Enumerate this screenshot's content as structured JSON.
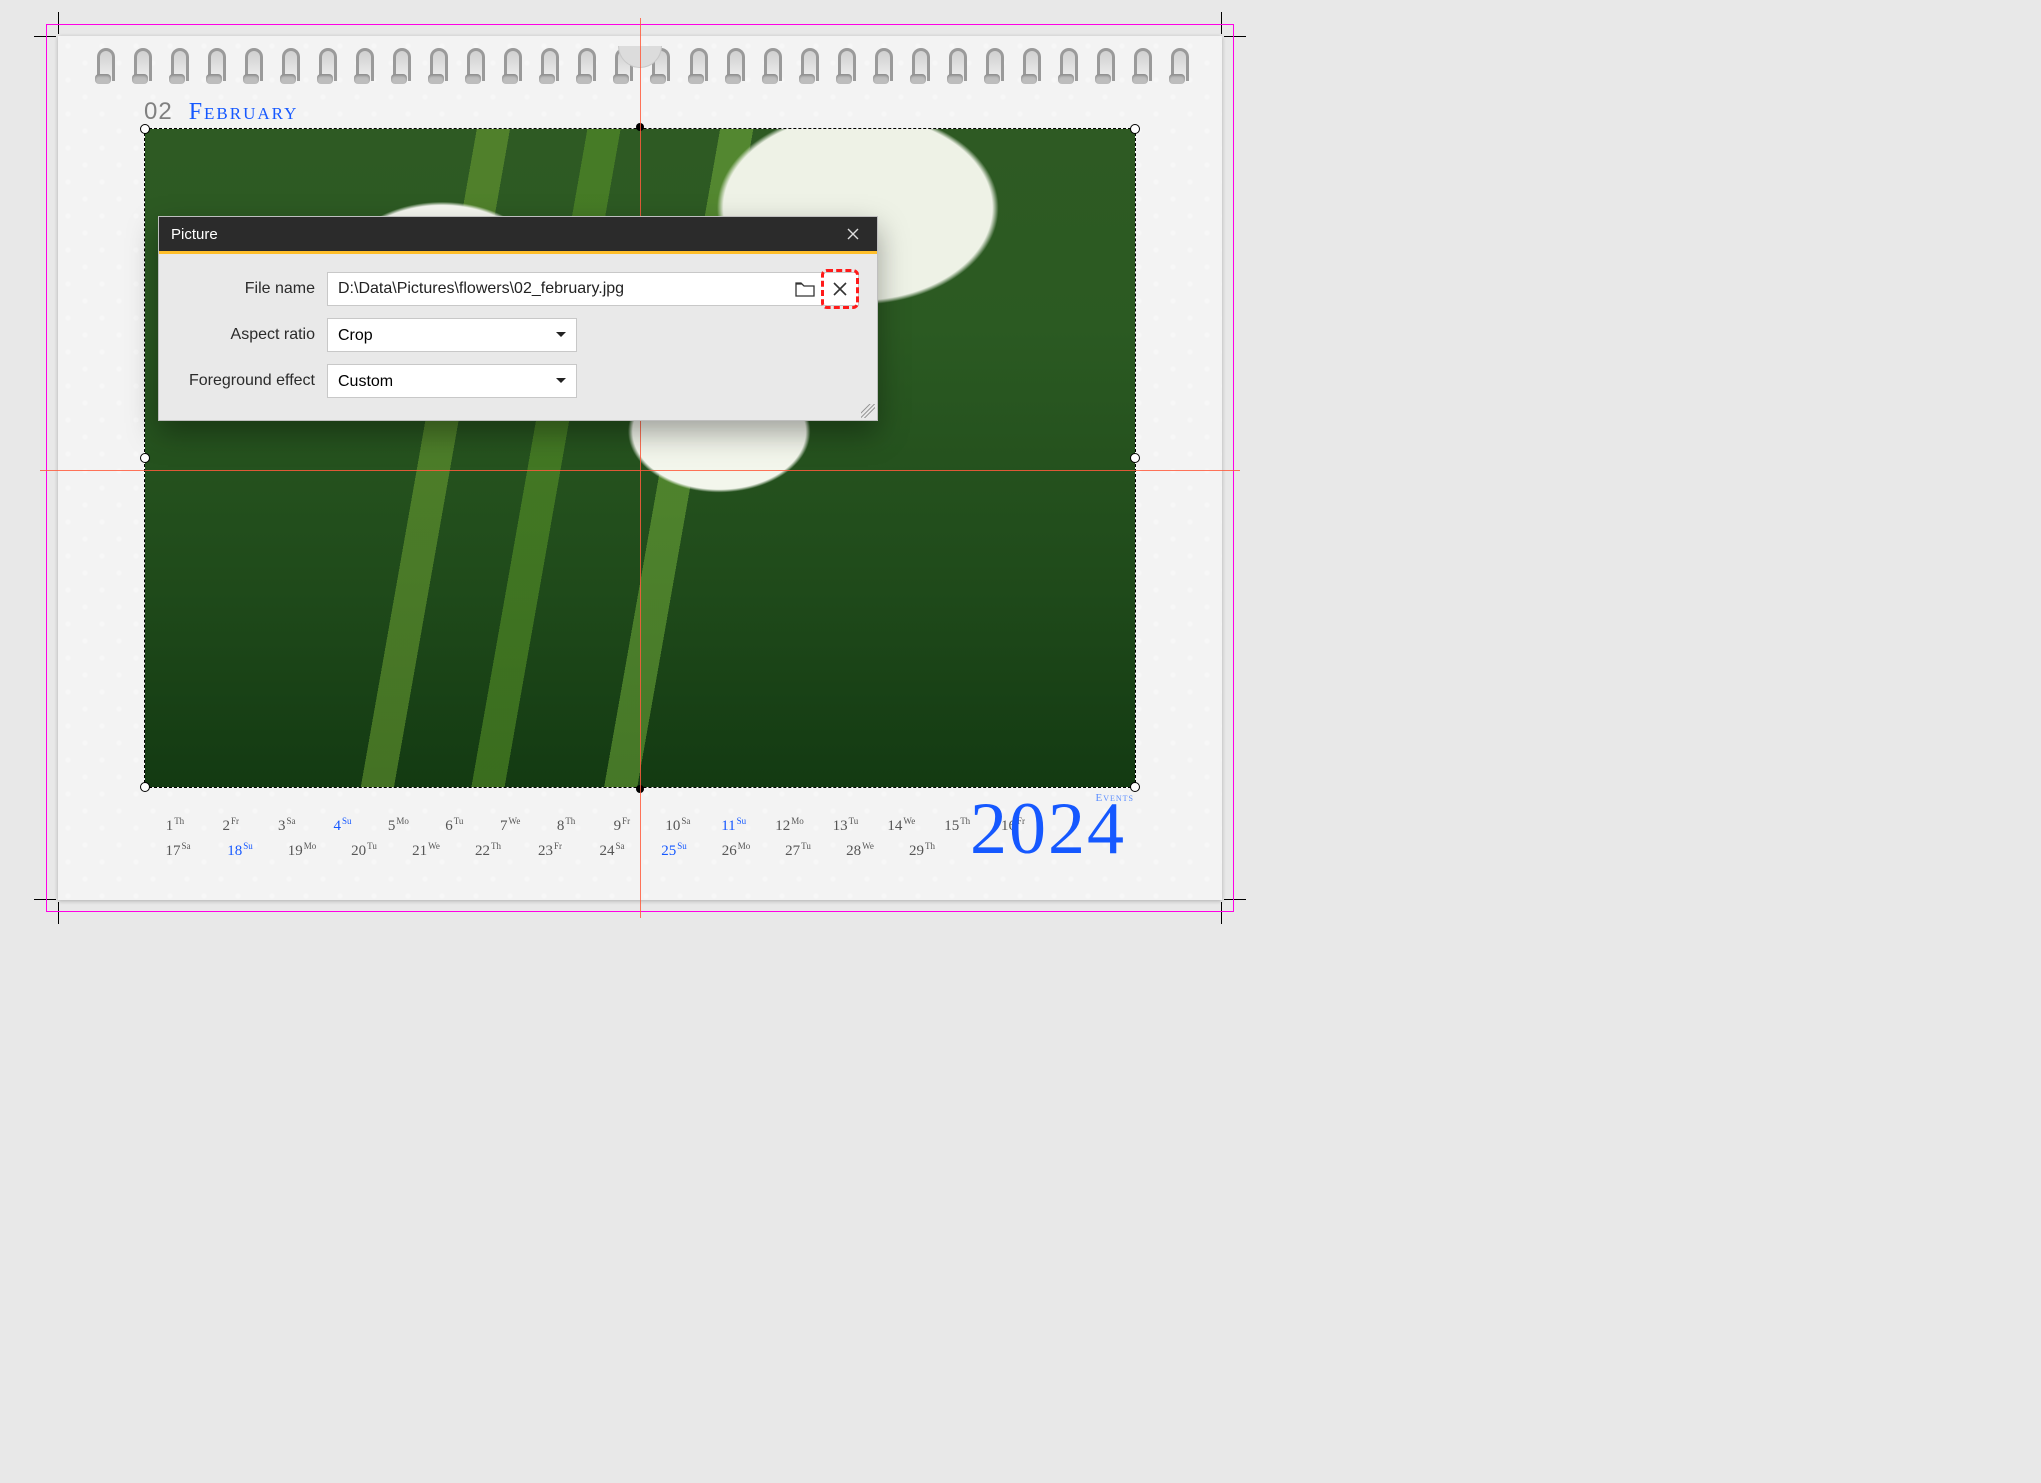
{
  "header": {
    "month_num": "02",
    "month_name": "February"
  },
  "year": "2024",
  "events_label": "Events",
  "dialog": {
    "title": "Picture",
    "fields": {
      "file_name_label": "File name",
      "file_name_value": "D:\\Data\\Pictures\\flowers\\02_february.jpg",
      "aspect_label": "Aspect ratio",
      "aspect_value": "Crop",
      "fg_label": "Foreground effect",
      "fg_value": "Custom"
    }
  },
  "calendar": {
    "rows": [
      [
        {
          "d": "1",
          "s": "Th"
        },
        {
          "d": "2",
          "s": "Fr"
        },
        {
          "d": "3",
          "s": "Sa"
        },
        {
          "d": "4",
          "s": "Su",
          "sun": true
        },
        {
          "d": "5",
          "s": "Mo"
        },
        {
          "d": "6",
          "s": "Tu"
        },
        {
          "d": "7",
          "s": "We"
        },
        {
          "d": "8",
          "s": "Th"
        },
        {
          "d": "9",
          "s": "Fr"
        },
        {
          "d": "10",
          "s": "Sa"
        },
        {
          "d": "11",
          "s": "Su",
          "sun": true
        },
        {
          "d": "12",
          "s": "Mo"
        },
        {
          "d": "13",
          "s": "Tu"
        },
        {
          "d": "14",
          "s": "We"
        },
        {
          "d": "15",
          "s": "Th"
        },
        {
          "d": "16",
          "s": "Fr"
        }
      ],
      [
        {
          "d": "17",
          "s": "Sa"
        },
        {
          "d": "18",
          "s": "Su",
          "sun": true
        },
        {
          "d": "19",
          "s": "Mo"
        },
        {
          "d": "20",
          "s": "Tu"
        },
        {
          "d": "21",
          "s": "We"
        },
        {
          "d": "22",
          "s": "Th"
        },
        {
          "d": "23",
          "s": "Fr"
        },
        {
          "d": "24",
          "s": "Sa"
        },
        {
          "d": "25",
          "s": "Su",
          "sun": true
        },
        {
          "d": "26",
          "s": "Mo"
        },
        {
          "d": "27",
          "s": "Tu"
        },
        {
          "d": "28",
          "s": "We"
        },
        {
          "d": "29",
          "s": "Th"
        }
      ]
    ]
  }
}
